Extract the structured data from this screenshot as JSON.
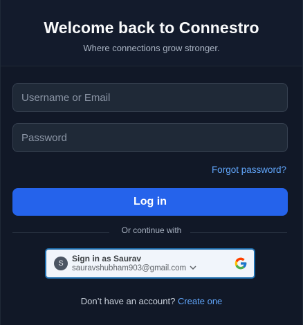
{
  "header": {
    "title": "Welcome back to Connestro",
    "subtitle": "Where connections grow stronger."
  },
  "form": {
    "username_placeholder": "Username or Email",
    "password_placeholder": "Password",
    "forgot_label": "Forgot password?",
    "login_label": "Log in"
  },
  "divider_text": "Or continue with",
  "google": {
    "avatar_initial": "S",
    "signin_label": "Sign in as Saurav",
    "email": "sauravshubham903@gmail.com",
    "border_color": "#1f6fb0"
  },
  "footer": {
    "prompt": "Don’t have an account?",
    "link_label": "Create one"
  },
  "colors": {
    "background": "#111827",
    "accent": "#2563eb",
    "link": "#60a5fa"
  }
}
